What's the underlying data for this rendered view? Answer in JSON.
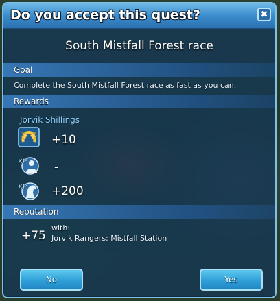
{
  "dialog": {
    "title": "Do you accept this quest?",
    "close_label": "✖"
  },
  "quest": {
    "name": "South Mistfall Forest race"
  },
  "goal": {
    "header": "Goal",
    "text": "Complete the South Mistfall Forest race as fast as you can."
  },
  "rewards": {
    "header": "Rewards",
    "currency_label": "Jorvik Shillings",
    "items": [
      {
        "icon": "horseshoe-wings-icon",
        "value": "+10"
      },
      {
        "icon": "xp-rider-icon",
        "value": "-"
      },
      {
        "icon": "xp-horse-icon",
        "value": "+200"
      }
    ]
  },
  "reputation": {
    "header": "Reputation",
    "value": "+75",
    "with_label": "with:",
    "faction": "Jorvik Rangers: Mistfall Station"
  },
  "buttons": {
    "no": "No",
    "yes": "Yes"
  },
  "colors": {
    "accent": "#3b8ccd",
    "button": "#2f9fd8",
    "border": "#7fc0e6"
  }
}
